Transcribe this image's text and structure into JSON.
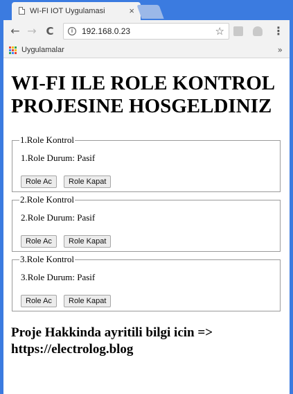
{
  "browser": {
    "tab_title": "WI-FI IOT Uygulamasi",
    "tab_close": "×",
    "url": "192.168.0.23",
    "bookmark_apps_label": "Uygulamalar",
    "bookmark_overflow": "»",
    "back": "←",
    "forward": "→",
    "reload": "C",
    "star": "☆",
    "menu": "⋮",
    "info": "i",
    "apps_icon_colors": [
      "#ea4335",
      "#fbbc05",
      "#34a853",
      "#4285f4",
      "#ea4335",
      "#fbbc05",
      "#34a853",
      "#4285f4",
      "#ea4335"
    ]
  },
  "page": {
    "heading": "WI-FI ILE ROLE KONTROL PROJESINE HOSGELDINIZ",
    "relays": [
      {
        "legend": "1.Role Kontrol",
        "status": "1.Role Durum: Pasif",
        "on_label": "Role Ac",
        "off_label": "Role Kapat"
      },
      {
        "legend": "2.Role Kontrol",
        "status": "2.Role Durum: Pasif",
        "on_label": "Role Ac",
        "off_label": "Role Kapat"
      },
      {
        "legend": "3.Role Kontrol",
        "status": "3.Role Durum: Pasif",
        "on_label": "Role Ac",
        "off_label": "Role Kapat"
      }
    ],
    "footer": "Proje Hakkinda ayritili bilgi icin => https://electrolog.blog"
  }
}
